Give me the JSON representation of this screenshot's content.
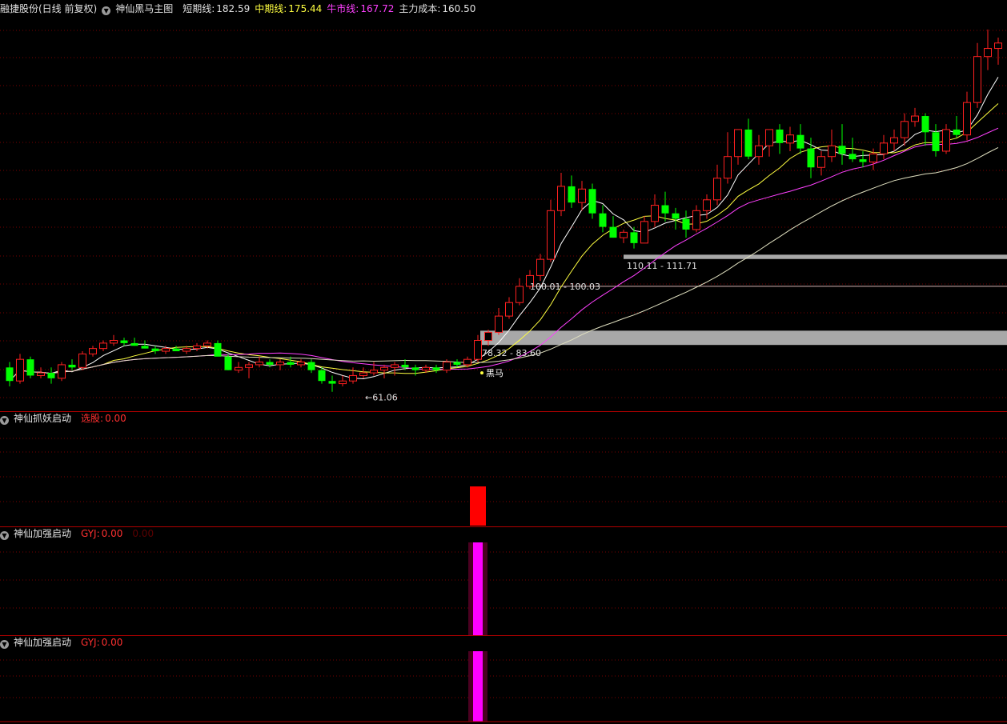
{
  "header": {
    "stock": "融捷股份(日线 前复权)",
    "indicator": "神仙黑马主图",
    "short_label": "短期线:",
    "short_value": "182.59",
    "mid_label": "中期线:",
    "mid_value": "175.44",
    "bull_label": "牛市线:",
    "bull_value": "167.72",
    "cost_label": "主力成本:",
    "cost_value": "160.50"
  },
  "panels": [
    {
      "title": "神仙抓妖启动",
      "field_label": "选股:",
      "field_value": "0.00",
      "extra": ""
    },
    {
      "title": "神仙加强启动",
      "field_label": "GYJ:",
      "field_value": "0.00",
      "extra": "0.00"
    },
    {
      "title": "神仙加强启动",
      "field_label": "GYJ:",
      "field_value": "0.00",
      "extra": ""
    }
  ],
  "annotations": {
    "low_price": "61.06",
    "start_label": "黑马",
    "zone1": "78.32 - 83.60",
    "zone2": "100.01 - 100.03",
    "zone3": "110.11 - 111.71"
  },
  "colors": {
    "background": "#000000",
    "up": "#ff2020",
    "down": "#00ff00",
    "grid": "#7a0000",
    "short_line": "#ffffff",
    "mid_line": "#ffff40",
    "bull_line": "#ff40ff",
    "cost_line": "#e0e0c0",
    "zone": "#a8a8a8",
    "signal_red": "#ff0000",
    "signal_magenta": "#ff00ff"
  },
  "chart_data": {
    "type": "candlestick",
    "y_range": [
      55,
      200
    ],
    "candles": [
      [
        70,
        72,
        63,
        65
      ],
      [
        65,
        75,
        64,
        73
      ],
      [
        73,
        74,
        66,
        67
      ],
      [
        67,
        70,
        66,
        68
      ],
      [
        68,
        70,
        64,
        66
      ],
      [
        66,
        72,
        65,
        71
      ],
      [
        71,
        73,
        69,
        70
      ],
      [
        70,
        76,
        69,
        75
      ],
      [
        75,
        78,
        74,
        77
      ],
      [
        77,
        80,
        76,
        79
      ],
      [
        79,
        82,
        78,
        80
      ],
      [
        80,
        81,
        78,
        79
      ],
      [
        79,
        81,
        78,
        78
      ],
      [
        78,
        80,
        77,
        77
      ],
      [
        77,
        78,
        75,
        76
      ],
      [
        76,
        78,
        75,
        77
      ],
      [
        77,
        78,
        76,
        76
      ],
      [
        76,
        78,
        75,
        77
      ],
      [
        77,
        79,
        76,
        78
      ],
      [
        78,
        80,
        77,
        79
      ],
      [
        79,
        80,
        75,
        74
      ],
      [
        74,
        75,
        69,
        69
      ],
      [
        69,
        72,
        68,
        70
      ],
      [
        70,
        72,
        66,
        71
      ],
      [
        71,
        74,
        70,
        72
      ],
      [
        72,
        73,
        70,
        71
      ],
      [
        71,
        73,
        69,
        72
      ],
      [
        72,
        74,
        70,
        71
      ],
      [
        71,
        73,
        70,
        72
      ],
      [
        72,
        73,
        68,
        69
      ],
      [
        69,
        70,
        64,
        65
      ],
      [
        65,
        67,
        61,
        64
      ],
      [
        64,
        67,
        63,
        65
      ],
      [
        65,
        70,
        64,
        67
      ],
      [
        67,
        70,
        66,
        68
      ],
      [
        68,
        72,
        67,
        69
      ],
      [
        69,
        71,
        66,
        70
      ],
      [
        70,
        72,
        67,
        71
      ],
      [
        71,
        73,
        69,
        70
      ],
      [
        70,
        71,
        67,
        69
      ],
      [
        69,
        71,
        68,
        70
      ],
      [
        70,
        71,
        68,
        69
      ],
      [
        69,
        73,
        68,
        72
      ],
      [
        72,
        73,
        70,
        71
      ],
      [
        71,
        74,
        70,
        73
      ],
      [
        73,
        82,
        72,
        80
      ],
      [
        80,
        84,
        78,
        83
      ],
      [
        83,
        92,
        82,
        89
      ],
      [
        89,
        96,
        88,
        94
      ],
      [
        94,
        103,
        93,
        100
      ],
      [
        100,
        106,
        99,
        104
      ],
      [
        104,
        112,
        102,
        110
      ],
      [
        110,
        132,
        109,
        128
      ],
      [
        128,
        142,
        126,
        137
      ],
      [
        137,
        141,
        129,
        131
      ],
      [
        131,
        139,
        128,
        136
      ],
      [
        136,
        138,
        125,
        127
      ],
      [
        127,
        130,
        120,
        122
      ],
      [
        122,
        126,
        118,
        118
      ],
      [
        118,
        121,
        116,
        120
      ],
      [
        120,
        122,
        114,
        116
      ],
      [
        116,
        126,
        116,
        124
      ],
      [
        124,
        134,
        122,
        130
      ],
      [
        130,
        135,
        124,
        127
      ],
      [
        127,
        129,
        121,
        125
      ],
      [
        125,
        128,
        118,
        121
      ],
      [
        121,
        130,
        120,
        128
      ],
      [
        128,
        134,
        125,
        132
      ],
      [
        132,
        145,
        130,
        140
      ],
      [
        140,
        157,
        138,
        148
      ],
      [
        148,
        154,
        145,
        158
      ],
      [
        158,
        162,
        147,
        148
      ],
      [
        148,
        156,
        145,
        152
      ],
      [
        152,
        157,
        148,
        158
      ],
      [
        158,
        160,
        149,
        153
      ],
      [
        153,
        159,
        150,
        156
      ],
      [
        156,
        160,
        149,
        151
      ],
      [
        151,
        155,
        140,
        144
      ],
      [
        144,
        150,
        141,
        148
      ],
      [
        148,
        158,
        146,
        152
      ],
      [
        152,
        160,
        145,
        149
      ],
      [
        149,
        155,
        146,
        147
      ],
      [
        147,
        150,
        144,
        146
      ],
      [
        146,
        151,
        143,
        149
      ],
      [
        149,
        156,
        147,
        153
      ],
      [
        153,
        158,
        150,
        155
      ],
      [
        155,
        164,
        152,
        161
      ],
      [
        161,
        166,
        159,
        163
      ],
      [
        163,
        164,
        152,
        157
      ],
      [
        157,
        160,
        148,
        150
      ],
      [
        150,
        160,
        149,
        158
      ],
      [
        158,
        163,
        155,
        156
      ],
      [
        156,
        172,
        154,
        168
      ],
      [
        168,
        190,
        166,
        185
      ],
      [
        185,
        195,
        180,
        188
      ],
      [
        188,
        192,
        182,
        190
      ]
    ],
    "series": [
      {
        "name": "短期线",
        "value": 182.59
      },
      {
        "name": "中期线",
        "value": 175.44
      },
      {
        "name": "牛市线",
        "value": 167.72
      },
      {
        "name": "主力成本",
        "value": 160.5
      }
    ],
    "zones": [
      [
        78.32,
        83.6
      ],
      [
        100.01,
        100.03
      ],
      [
        110.11,
        111.71
      ]
    ],
    "signal_index": 45
  }
}
